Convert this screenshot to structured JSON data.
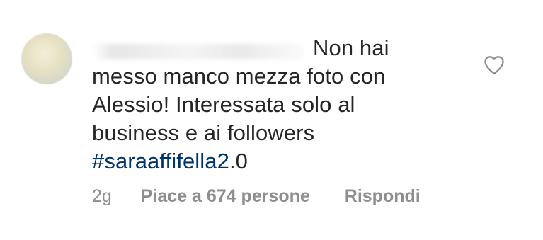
{
  "comment": {
    "lines": [
      "Non hai",
      "messo manco mezza foto con",
      "Alessio! Interessata solo al",
      "business e ai followers"
    ],
    "hashtag": "#saraaffifella2",
    "hashtag_suffix": ".0"
  },
  "meta": {
    "time": "2g",
    "likes": "Piace a 674 persone",
    "reply": "Rispondi"
  },
  "icons": {
    "like": "heart-outline-icon"
  },
  "colors": {
    "text": "#262626",
    "hashtag": "#003569",
    "meta": "#8e8e8e"
  }
}
